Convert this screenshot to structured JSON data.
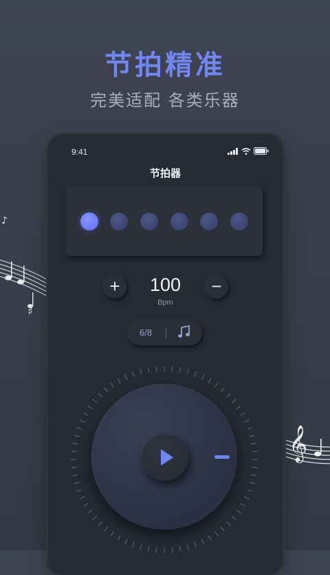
{
  "promo": {
    "headline": "节拍精准",
    "subline": "完美适配 各类乐器"
  },
  "phone": {
    "status": {
      "time": "9:41"
    },
    "title": "节拍器",
    "beats": {
      "count": 6,
      "active_index": 0
    },
    "tempo": {
      "value": "100",
      "unit": "Bpm",
      "increase_label": "+",
      "decrease_label": "−"
    },
    "meter": {
      "value": "6/8"
    }
  },
  "colors": {
    "accent": "#6f86f3",
    "beat_active": "#6c7ef8",
    "beat_idle": "#3f476d"
  }
}
